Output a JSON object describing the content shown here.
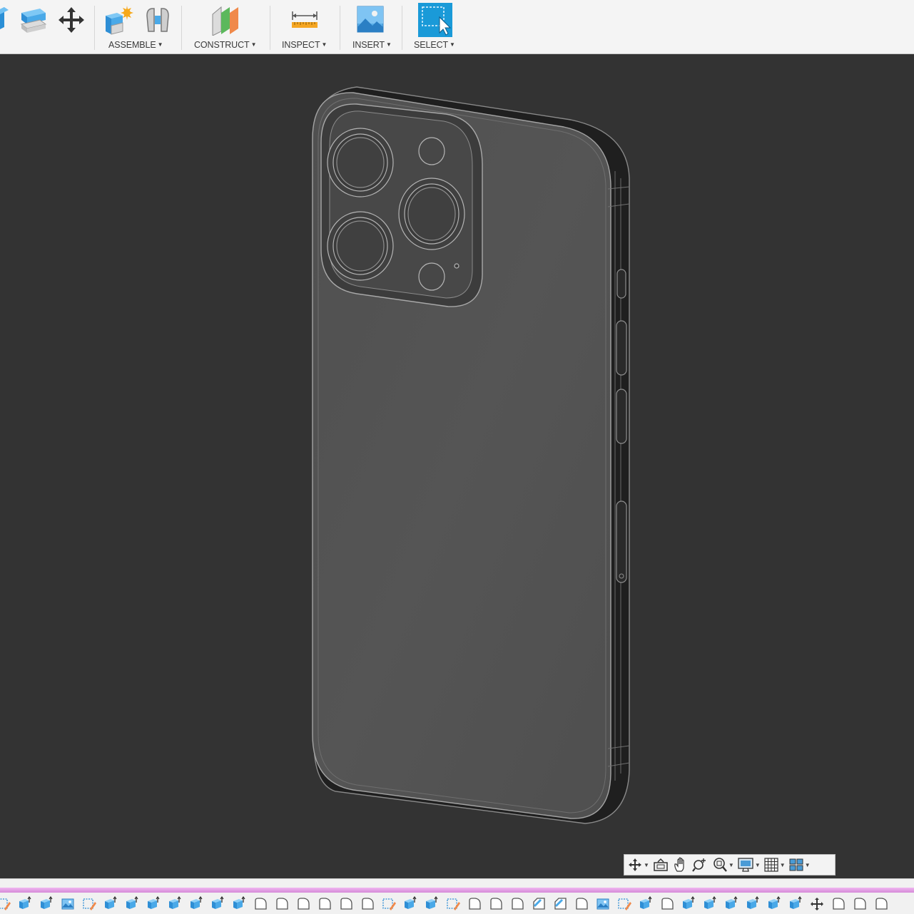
{
  "toolbar": {
    "groups": [
      {
        "label": "ASSEMBLE",
        "icons": [
          "new-component-icon",
          "joint-icon"
        ]
      },
      {
        "label": "CONSTRUCT",
        "icons": [
          "offset-plane-icon"
        ]
      },
      {
        "label": "INSPECT",
        "icons": [
          "measure-icon"
        ]
      },
      {
        "label": "INSERT",
        "icons": [
          "insert-image-icon"
        ]
      },
      {
        "label": "SELECT",
        "icons": [
          "select-box-icon"
        ]
      }
    ],
    "left_icons": [
      "extrude-icon",
      "press-pull-icon",
      "move-icon"
    ],
    "select_active": true,
    "accent_color": "#1a9ad8"
  },
  "viewport": {
    "background_color": "#333333",
    "model": "phone-body-wireframe"
  },
  "navbar": {
    "tools": [
      "orbit-icon",
      "look-at-icon",
      "pan-icon",
      "zoom-icon",
      "fit-icon",
      "display-settings-icon",
      "grid-settings-icon",
      "viewports-icon"
    ]
  },
  "timeline": {
    "stripe_color": "#e6a3e8",
    "items": [
      "sketch",
      "extrude",
      "extrude",
      "image",
      "sketch",
      "extrude",
      "extrude",
      "extrude",
      "extrude",
      "extrude",
      "extrude",
      "extrude",
      "fillet",
      "fillet",
      "fillet",
      "fillet",
      "fillet",
      "fillet",
      "sketch",
      "extrude",
      "extrude",
      "sketch",
      "fillet",
      "fillet",
      "fillet",
      "chamfer",
      "chamfer",
      "fillet",
      "image",
      "sketch",
      "extrude",
      "fillet",
      "extrude",
      "extrude",
      "extrude",
      "extrude",
      "extrude",
      "extrude",
      "move",
      "fillet",
      "fillet",
      "fillet"
    ]
  }
}
